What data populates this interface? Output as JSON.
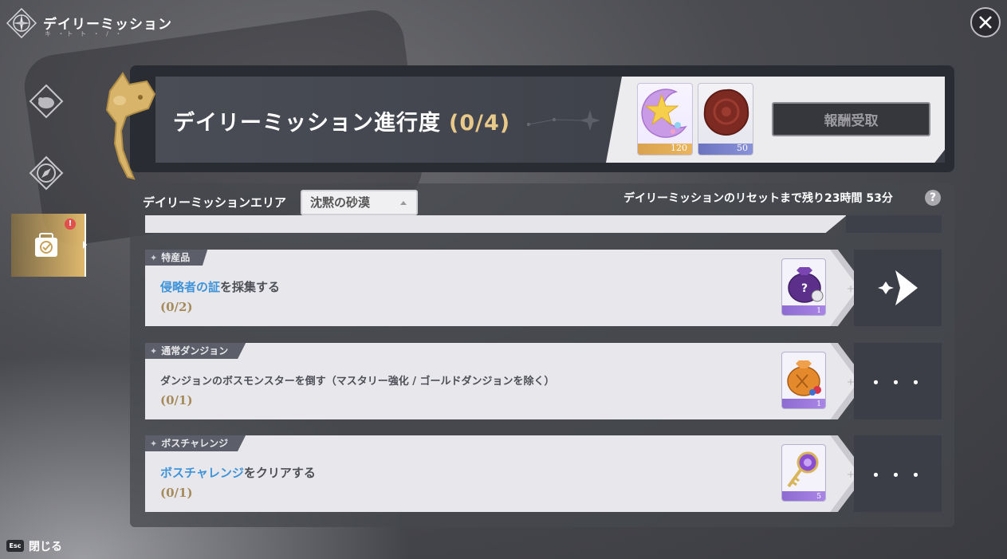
{
  "window": {
    "title": "デイリーミッション",
    "subtitle": "キ ・ト ト ・ / ・"
  },
  "header": {
    "title": "デイリーミッション進行度",
    "progress": "(0/4)",
    "rewards": [
      {
        "icon": "crescent-star-gem-icon",
        "count": "120"
      },
      {
        "icon": "red-wax-seal-icon",
        "count": "50"
      }
    ],
    "claim_label": "報酬受取"
  },
  "area": {
    "label": "デイリーミッションエリア",
    "selected": "沈黙の砂漠"
  },
  "reset_text": "デイリーミッションのリセットまで残り23時間 53分",
  "help_symbol": "?",
  "missions": [
    {
      "tag": "特産品",
      "desc_highlight": "侵略者の証",
      "desc_rest": "を採集する",
      "progress": "(0/2)",
      "item_icon": "purple-mystery-bag-icon",
      "qty": "1",
      "action": "go-arrow-icon"
    },
    {
      "tag": "通常ダンジョン",
      "desc": "ダンジョンのボスモンスターを倒す（マスタリー強化 / ゴールドダンジョンを除く）",
      "progress": "(0/1)",
      "item_icon": "orange-loot-bag-icon",
      "qty": "1",
      "action_label": "・・・"
    },
    {
      "tag": "ボスチャレンジ",
      "desc_highlight": "ボスチャレンジ",
      "desc_rest": "をクリアする",
      "progress": "(0/1)",
      "item_icon": "golden-key-icon",
      "qty": "5",
      "action_label": "・・・"
    }
  ],
  "footer": {
    "esc_key": "Esc",
    "close_label": "閉じる"
  },
  "colors": {
    "highlight_text": "#3f93d9",
    "progress_text": "#a58a5c",
    "header_progress": "#e8c98a",
    "active_tab": "#e6be6e"
  }
}
